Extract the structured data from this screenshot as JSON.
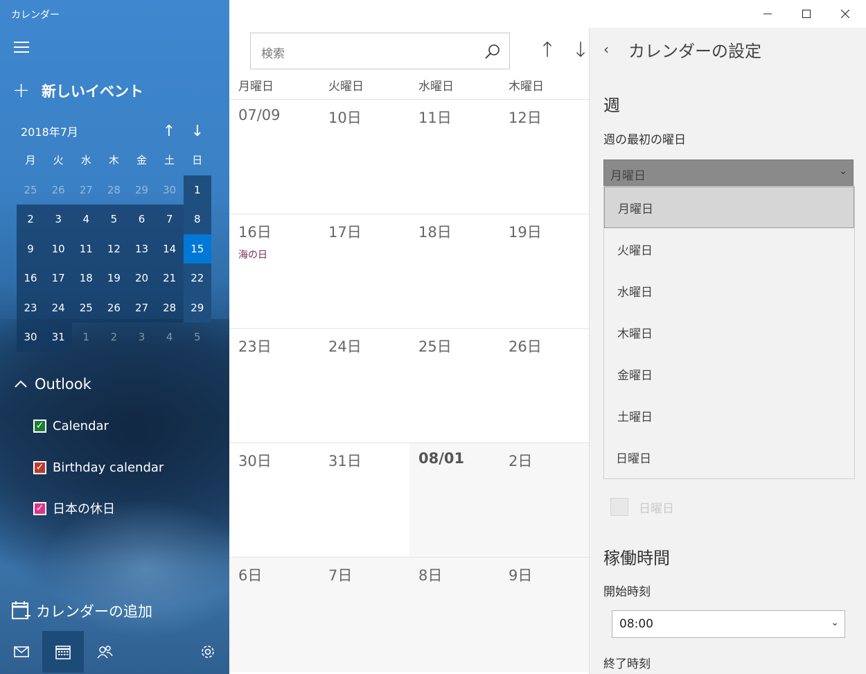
{
  "app": {
    "title": "カレンダー"
  },
  "sidebar": {
    "new_event_label": "新しいイベント",
    "mini_calendar": {
      "month_label": "2018年7月",
      "weekdays": [
        "月",
        "火",
        "水",
        "木",
        "金",
        "土",
        "日"
      ],
      "weeks": [
        [
          "25",
          "26",
          "27",
          "28",
          "29",
          "30",
          "1"
        ],
        [
          "2",
          "3",
          "4",
          "5",
          "6",
          "7",
          "8"
        ],
        [
          "9",
          "10",
          "11",
          "12",
          "13",
          "14",
          "15"
        ],
        [
          "16",
          "17",
          "18",
          "19",
          "20",
          "21",
          "22"
        ],
        [
          "23",
          "24",
          "25",
          "26",
          "27",
          "28",
          "29"
        ],
        [
          "30",
          "31",
          "1",
          "2",
          "3",
          "4",
          "5"
        ]
      ],
      "today": "15"
    },
    "account": {
      "name": "Outlook"
    },
    "calendars": [
      {
        "label": "Calendar",
        "color": "#1e7d32"
      },
      {
        "label": "Birthday calendar",
        "color": "#c0392b"
      },
      {
        "label": "日本の休日",
        "color": "#e0338a"
      }
    ],
    "add_calendar_label": "カレンダーの追加"
  },
  "main": {
    "search_placeholder": "検索",
    "weekday_headers": [
      "月曜日",
      "火曜日",
      "水曜日",
      "木曜日"
    ],
    "weeks": [
      [
        "07/09",
        "10日",
        "11日",
        "12日"
      ],
      [
        "16日",
        "17日",
        "18日",
        "19日"
      ],
      [
        "23日",
        "24日",
        "25日",
        "26日"
      ],
      [
        "30日",
        "31日",
        "08/01",
        "2日"
      ],
      [
        "6日",
        "7日",
        "8日",
        "9日"
      ]
    ],
    "holiday_label": "海の日"
  },
  "settings": {
    "title": "カレンダーの設定",
    "week_section": "週",
    "first_day_label": "週の最初の曜日",
    "first_day_value": "月曜日",
    "first_day_options": [
      "月曜日",
      "火曜日",
      "水曜日",
      "木曜日",
      "金曜日",
      "土曜日",
      "日曜日"
    ],
    "disabled_check_label": "日曜日",
    "work_hours_section": "稼働時間",
    "start_time_label": "開始時刻",
    "start_time_value": "08:00",
    "end_time_label": "終了時刻"
  },
  "colors": {
    "accent": "#0078d7",
    "today": "#0078d7"
  }
}
